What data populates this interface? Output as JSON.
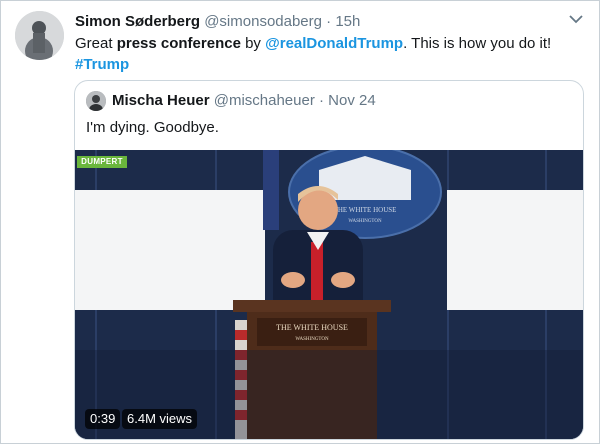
{
  "tweet": {
    "author_name": "Simon Søderberg",
    "author_handle": "@simonsodaberg",
    "separator": "·",
    "time": "15h",
    "text_1": "Great ",
    "text_bold_1": "press conference",
    "text_2": " by ",
    "mention": "@realDonaldTrump",
    "text_3": ". This is how you do it!",
    "hashtag": "#Trump"
  },
  "quoted": {
    "author_name": "Mischa Heuer",
    "author_handle": "@mischaheuer",
    "separator": "·",
    "date": "Nov 24",
    "text": "I'm dying. Goodbye."
  },
  "video": {
    "duration": "0:39",
    "views": "6.4M views",
    "watermark": "DUMPERT",
    "seal_text": "THE WHITE HOUSE",
    "seal_subtext": "WASHINGTON",
    "podium_text": "THE WHITE HOUSE",
    "podium_subtext": "WASHINGTON"
  },
  "icons": {
    "caret": "chevron-down-icon"
  }
}
